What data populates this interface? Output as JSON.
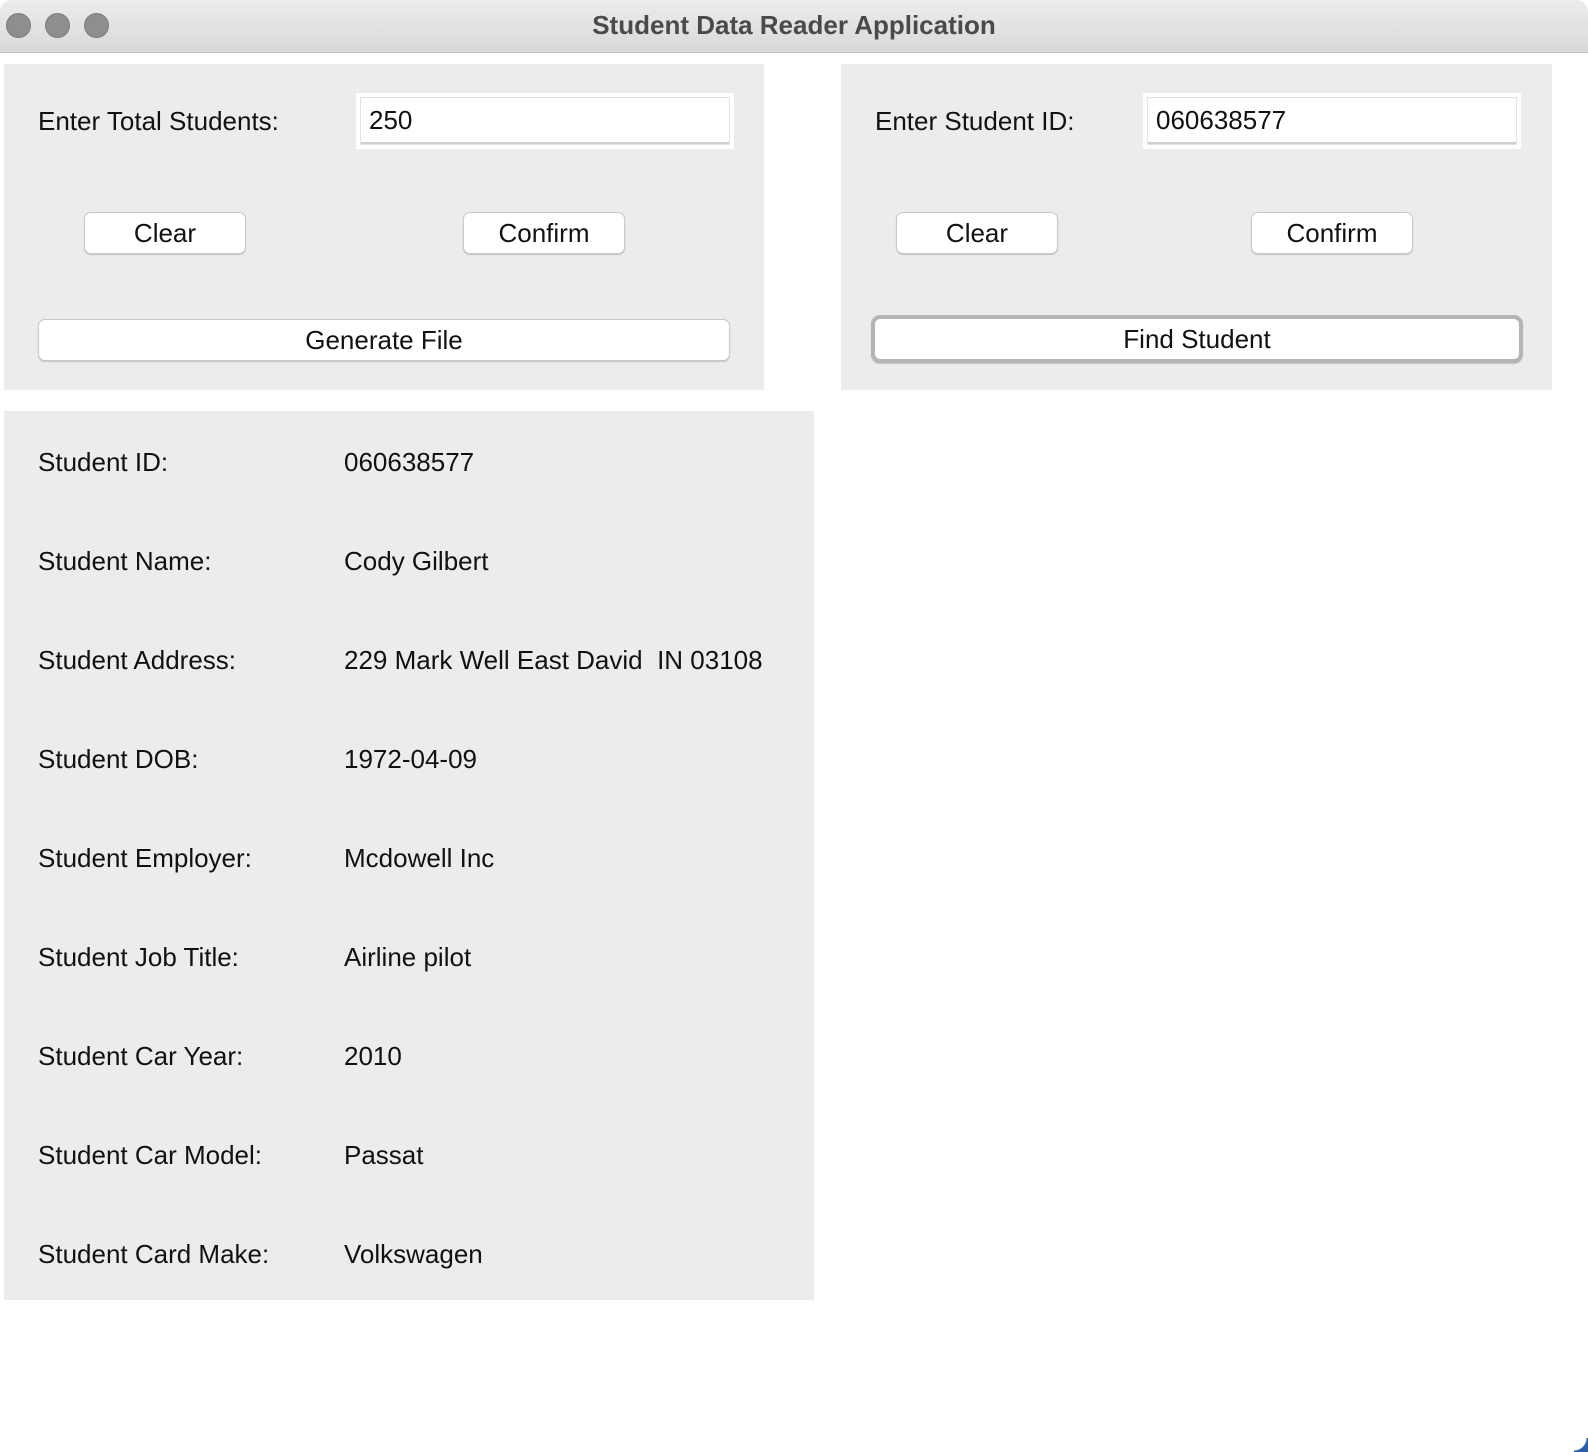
{
  "window": {
    "title": "Student Data Reader Application"
  },
  "generate_panel": {
    "total_label": "Enter Total Students:",
    "total_value": "250",
    "clear_label": "Clear",
    "confirm_label": "Confirm",
    "generate_label": "Generate File"
  },
  "find_panel": {
    "id_label": "Enter Student ID:",
    "id_value": "060638577",
    "clear_label": "Clear",
    "confirm_label": "Confirm",
    "find_label": "Find Student"
  },
  "student_info": {
    "rows": [
      {
        "label": "Student ID:",
        "value": "060638577"
      },
      {
        "label": "Student Name:",
        "value": "Cody Gilbert"
      },
      {
        "label": "Student Address:",
        "value": "229 Mark Well East David  IN 03108"
      },
      {
        "label": "Student DOB:",
        "value": "1972-04-09"
      },
      {
        "label": "Student Employer:",
        "value": "Mcdowell Inc"
      },
      {
        "label": "Student Job Title:",
        "value": "Airline pilot"
      },
      {
        "label": "Student Car Year:",
        "value": "2010"
      },
      {
        "label": "Student Car Model:",
        "value": "Passat"
      },
      {
        "label": "Student Card Make:",
        "value": "Volkswagen"
      }
    ]
  },
  "colors": {
    "panel_bg": "#ececec",
    "window_bg": "#ffffff",
    "titlebar": "#dcdcdc"
  }
}
